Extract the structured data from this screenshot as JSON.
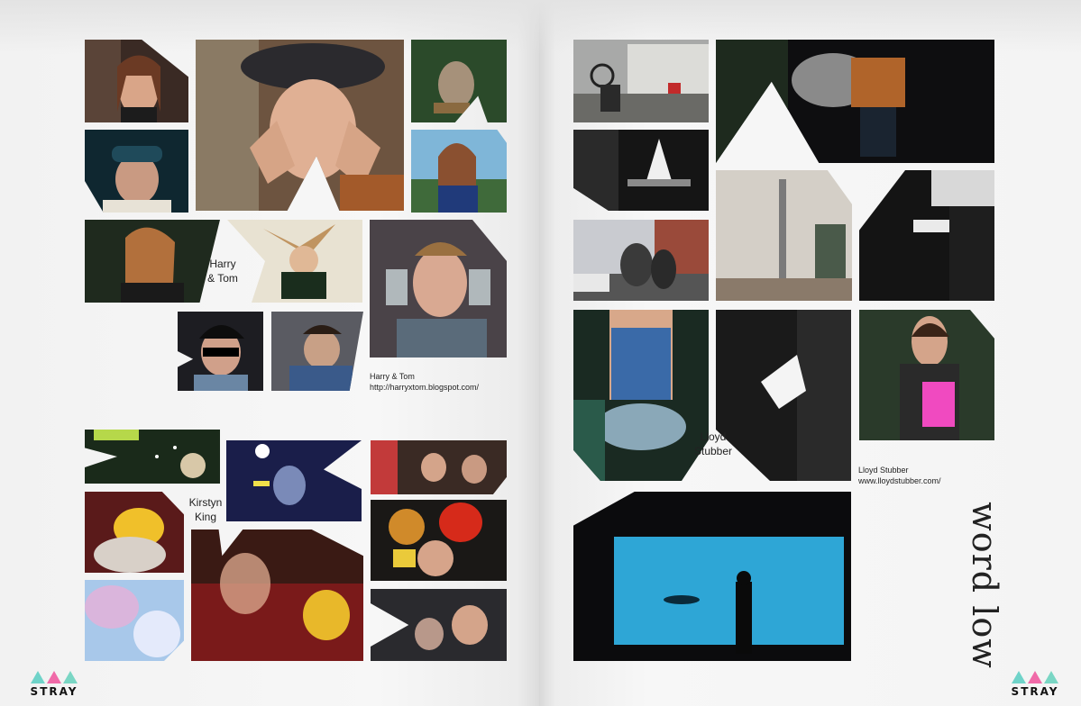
{
  "spread": {
    "title": "word low"
  },
  "left_page": {
    "caption_harry_tom": "Harry\n& Tom",
    "credit_harry_tom": {
      "name": "Harry & Tom",
      "url": "http://harryxtom.blogspot.com/"
    },
    "caption_kirstyn": "Kirstyn\nKing"
  },
  "right_page": {
    "caption_lloyd": "Lloyd\nStubber",
    "credit_lloyd": {
      "name": "Lloyd Stubber",
      "url": "www.lloydstubber.com/"
    }
  },
  "logo": {
    "word": "STRAY",
    "colors": [
      "#6fd3c9",
      "#f06aa8",
      "#7ad6c4"
    ]
  },
  "colors": {
    "paper": "#f6f6f6",
    "text": "#222222"
  }
}
